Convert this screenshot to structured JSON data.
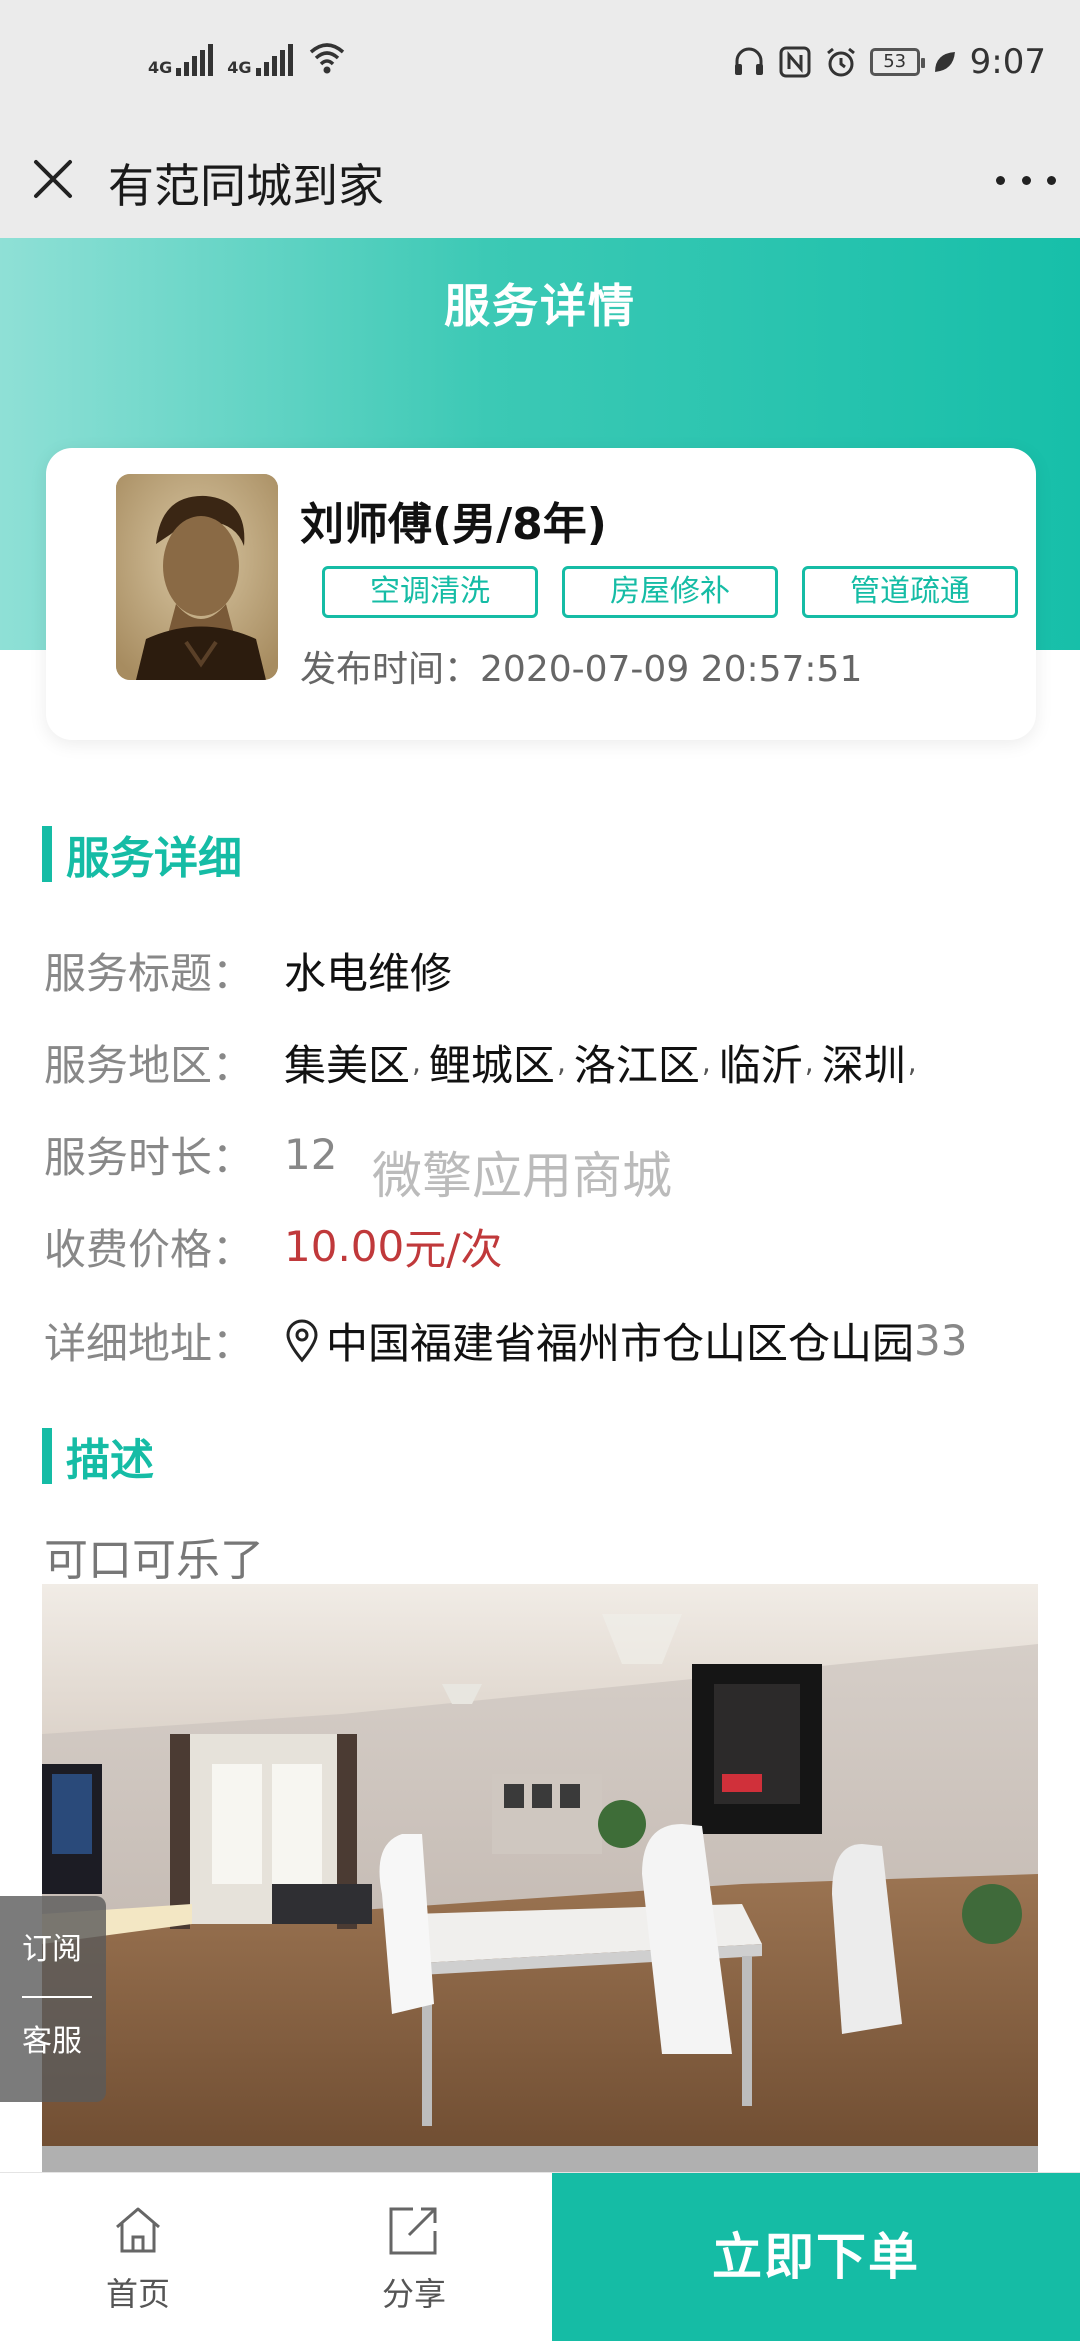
{
  "status_bar": {
    "net1": "4G",
    "net2": "4G",
    "battery": "53",
    "time": "9:07"
  },
  "title_bar": {
    "title": "有范同城到家"
  },
  "hero": {
    "title": "服务详情"
  },
  "profile": {
    "name": "刘师傅(男/8年)",
    "tags": [
      "空调清洗",
      "房屋修补",
      "管道疏通"
    ],
    "publish_label": "发布时间：",
    "publish_time": "2020-07-09 20:57:51"
  },
  "section_detail": {
    "title": "服务详细",
    "rows": {
      "title_label": "服务标题：",
      "title_value": "水电维修",
      "area_label": "服务地区：",
      "areas": [
        "集美区",
        "鲤城区",
        "洛江区",
        "临沂",
        "深圳"
      ],
      "separator": ",",
      "duration_label": "服务时长：",
      "duration_value": "12",
      "price_label": "收费价格：",
      "price_number": "10.00",
      "price_unit": "元/次",
      "address_label": "详细地址：",
      "address_main": "中国福建省福州市仓山区仓山园",
      "address_tail": "33"
    }
  },
  "watermark": "微擎应用商城",
  "section_desc": {
    "title": "描述",
    "text": "可口可乐了"
  },
  "side_float": {
    "subscribe": "订阅",
    "service": "客服"
  },
  "bottom_bar": {
    "home_label": "首页",
    "share_label": "分享",
    "order_label": "立即下单"
  },
  "colors": {
    "accent": "#15bca5",
    "price": "#c0393b"
  }
}
